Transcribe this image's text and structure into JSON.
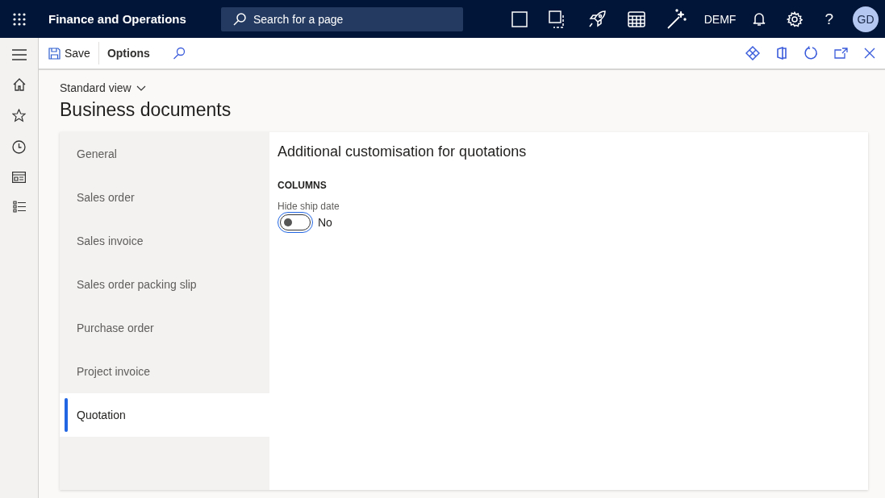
{
  "app": {
    "title": "Finance and Operations",
    "search_placeholder": "Search for a page",
    "company": "DEMF",
    "help": "?",
    "avatar": "GD"
  },
  "toolbar": {
    "save": "Save",
    "options": "Options"
  },
  "view": "Standard view",
  "page_title": "Business documents",
  "tabs": [
    {
      "label": "General",
      "selected": false
    },
    {
      "label": "Sales order",
      "selected": false
    },
    {
      "label": "Sales invoice",
      "selected": false
    },
    {
      "label": "Sales order packing slip",
      "selected": false
    },
    {
      "label": "Purchase order",
      "selected": false
    },
    {
      "label": "Project invoice",
      "selected": false
    },
    {
      "label": "Quotation",
      "selected": true
    }
  ],
  "panel": {
    "title": "Additional customisation for quotations",
    "group": "COLUMNS",
    "fields": [
      {
        "label": "Hide ship date",
        "on": false,
        "value": "No"
      }
    ]
  }
}
